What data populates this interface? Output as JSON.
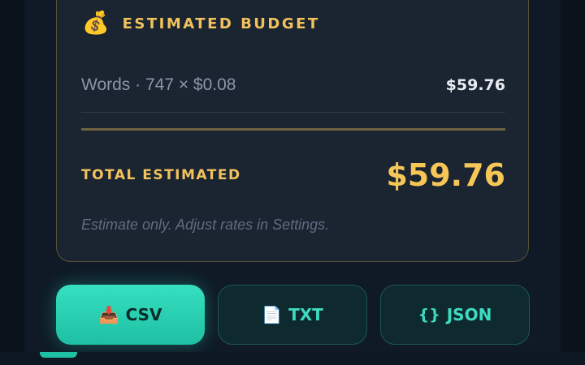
{
  "budget": {
    "icon": "money-bag-icon",
    "title": "ESTIMATED BUDGET",
    "line_item_label": "Words · 747 × $0.08",
    "line_item_value": "$59.76",
    "total_label": "TOTAL ESTIMATED",
    "total_value": "$59.76",
    "note": "Estimate only. Adjust rates in Settings."
  },
  "export": {
    "csv": {
      "icon": "download-tray-icon",
      "label": "CSV"
    },
    "txt": {
      "icon": "document-icon",
      "label": "TXT"
    },
    "json": {
      "icon": "braces-icon",
      "icon_text": "{}",
      "label": "JSON"
    }
  },
  "colors": {
    "accent_gold": "#f2c35c",
    "accent_teal": "#3ddbc0",
    "card_bg": "#1b2431"
  }
}
